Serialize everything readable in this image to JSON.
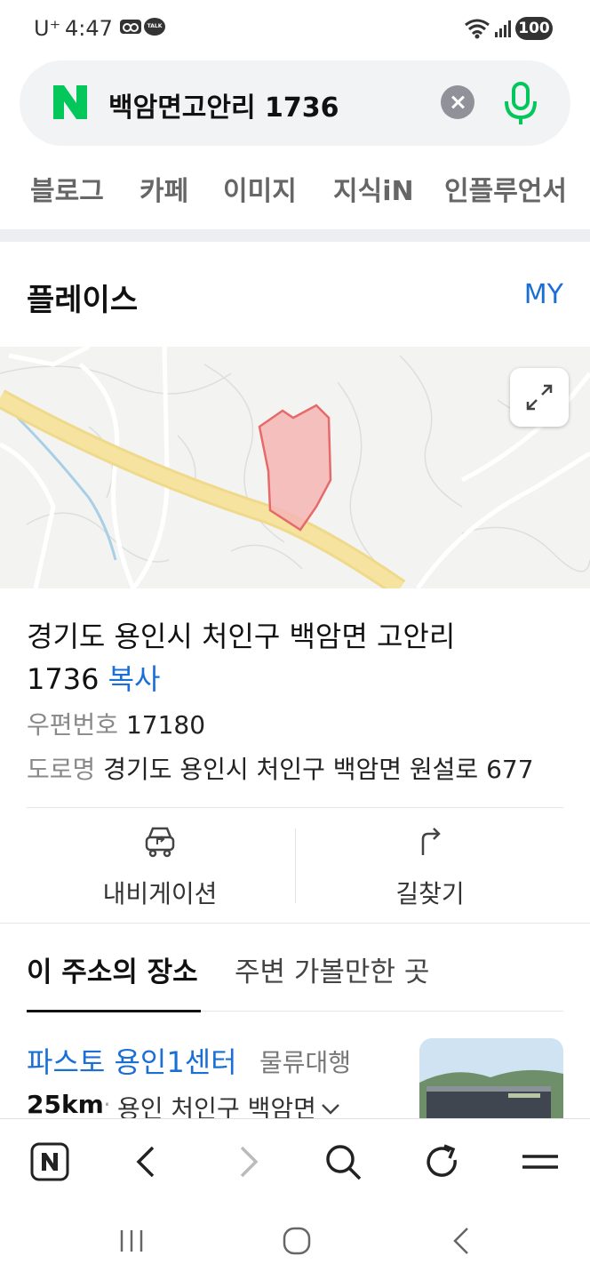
{
  "status_bar": {
    "carrier": "U⁺",
    "time": "4:47",
    "battery": "100"
  },
  "search": {
    "logo_letter": "N",
    "query": "백암면고안리 1736",
    "brand_color": "#03c75a"
  },
  "tabs": [
    {
      "label": "블로그"
    },
    {
      "label": "카페"
    },
    {
      "label": "이미지"
    },
    {
      "label": "지식iN"
    },
    {
      "label": "인플루언서"
    }
  ],
  "place": {
    "title": "플레이스",
    "my_label": "MY",
    "address_line": "경기도 용인시 처인구 백암면 고안리",
    "address_number": "1736",
    "copy_label": "복사",
    "postal_label": "우편번호",
    "postal_code": "17180",
    "road_label": "도로명",
    "road_address": "경기도 용인시 처인구 백암면 원설로 677",
    "actions": [
      {
        "label": "내비게이션",
        "icon": "car-navigation-icon"
      },
      {
        "label": "길찾기",
        "icon": "directions-arrow-icon"
      }
    ]
  },
  "subtabs": {
    "active": "이 주소의 장소",
    "inactive": "주변 가볼만한 곳"
  },
  "result": {
    "name": "파스토 용인1센터",
    "category": "물류대행",
    "distance": "25km",
    "separator": "·",
    "address": "용인 처인구 백암면"
  },
  "colors": {
    "accent_blue": "#1a6fd6",
    "parcel_fill": "#f5b5b5",
    "parcel_stroke": "#e56a6a",
    "road": "#f4dc8c"
  }
}
